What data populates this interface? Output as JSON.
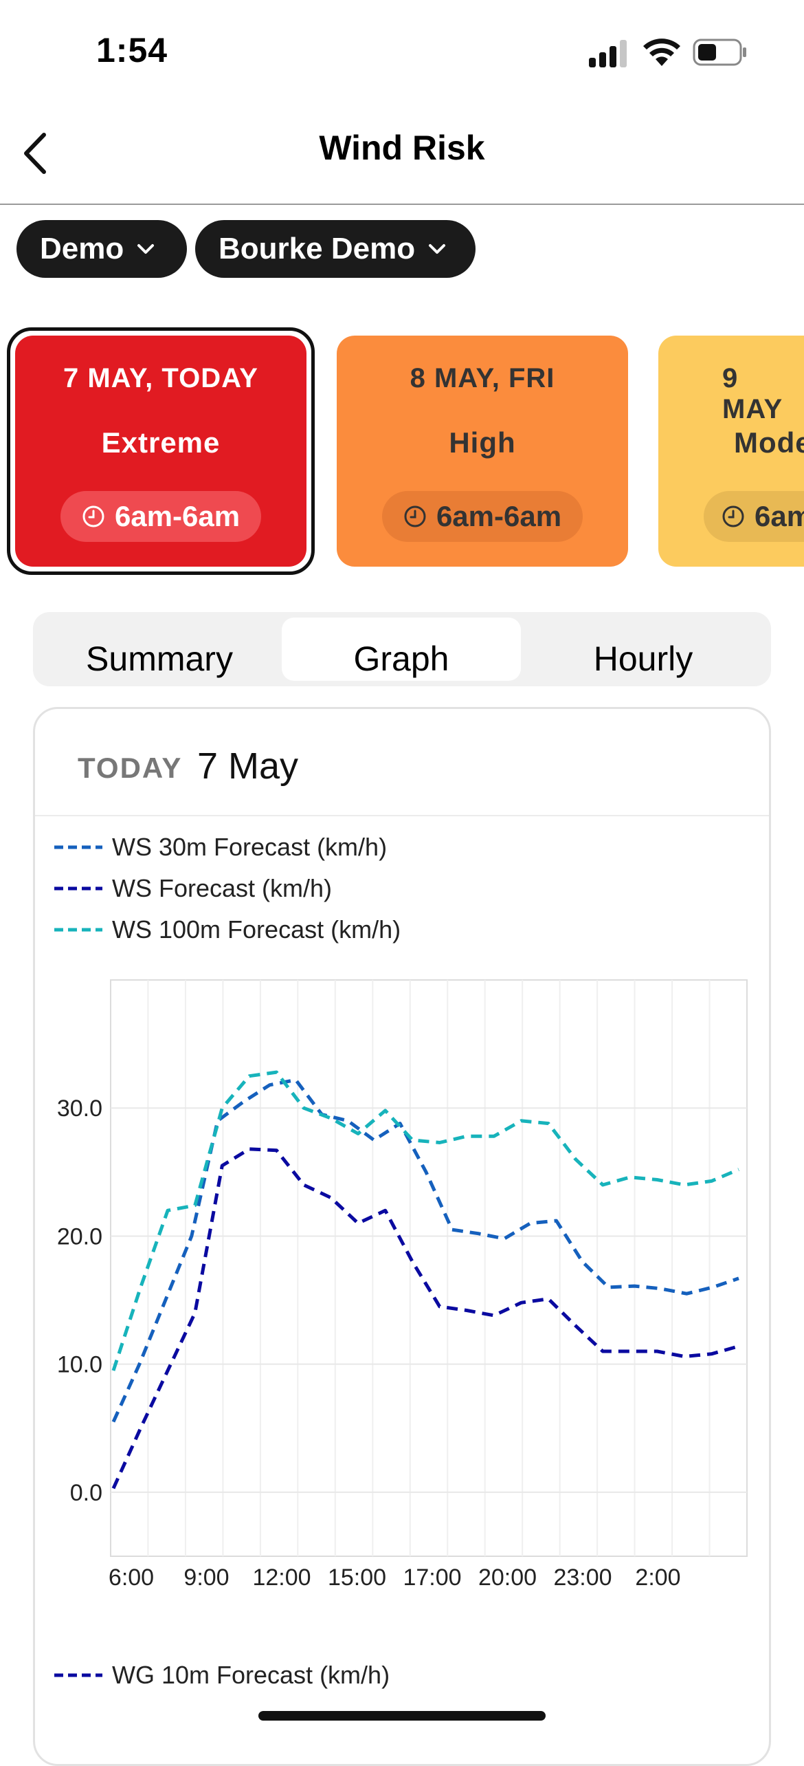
{
  "status_bar": {
    "time": "1:54"
  },
  "nav": {
    "title": "Wind Risk"
  },
  "filters": {
    "group": "Demo",
    "site": "Bourke Demo"
  },
  "days": [
    {
      "date": "7 MAY, TODAY",
      "level": "Extreme",
      "time": "6am-6am",
      "color": "#e11b22",
      "text_color": "#ffffff",
      "pill_color": "#ef4a50"
    },
    {
      "date": "8 MAY, FRI",
      "level": "High",
      "time": "6am-6am",
      "color": "#fb8c3d",
      "text_color": "#333333",
      "pill_color": "#e97d35"
    },
    {
      "date": "9 MAY",
      "level": "Mode",
      "time": "6am",
      "color": "#fccb5e",
      "text_color": "#333333",
      "pill_color": "#e8b954"
    }
  ],
  "tabs": [
    "Summary",
    "Graph",
    "Hourly"
  ],
  "active_tab": "Graph",
  "graph": {
    "day_label": "TODAY",
    "date": "7 May"
  },
  "legend": {
    "ws30": "WS 30m Forecast (km/h)",
    "ws": "WS Forecast (km/h)",
    "ws100": "WS 100m Forecast (km/h)",
    "wg10": "WG 10m Forecast (km/h)"
  },
  "chart_data": {
    "type": "line",
    "x_ticks": [
      "6:00",
      "9:00",
      "12:00",
      "15:00",
      "17:00",
      "20:00",
      "23:00",
      "2:00"
    ],
    "y_ticks": [
      "0.0",
      "10.0",
      "20.0",
      "30.0"
    ],
    "ylim": [
      -5,
      40
    ],
    "x_hours": [
      0,
      1,
      2,
      3,
      3.5,
      4,
      5,
      6,
      7,
      8,
      9,
      10,
      11,
      12,
      13,
      14,
      15,
      16,
      17,
      18,
      19,
      20,
      21,
      22,
      23,
      24
    ],
    "series": [
      {
        "name": "WS 30m Forecast (km/h)",
        "color": "#1560bd",
        "values": [
          5.5,
          10,
          15,
          20,
          29,
          30.5,
          31.8,
          32.2,
          29.5,
          29,
          27.5,
          28.8,
          25,
          20.5,
          20.2,
          19.8,
          21,
          21.2,
          18,
          16,
          16.1,
          15.9,
          15.5,
          16,
          16.7
        ]
      },
      {
        "name": "WS Forecast (km/h)",
        "color": "#0a0aa0",
        "values": [
          0.3,
          5,
          9.5,
          14,
          25.5,
          26.8,
          26.7,
          24,
          23,
          21,
          22,
          18,
          14.5,
          14.2,
          13.8,
          14.8,
          15.1,
          13,
          11,
          11,
          11,
          10.6,
          10.8,
          11.4
        ]
      },
      {
        "name": "WS 100m Forecast (km/h)",
        "color": "#17b3bb",
        "values": [
          9.5,
          16,
          22,
          22.4,
          30,
          32.5,
          32.8,
          30,
          29.2,
          28,
          29.8,
          27.5,
          27.3,
          27.8,
          27.8,
          29,
          28.8,
          26,
          24,
          24.6,
          24.4,
          24,
          24.3,
          25.2
        ]
      }
    ],
    "grid": true
  }
}
